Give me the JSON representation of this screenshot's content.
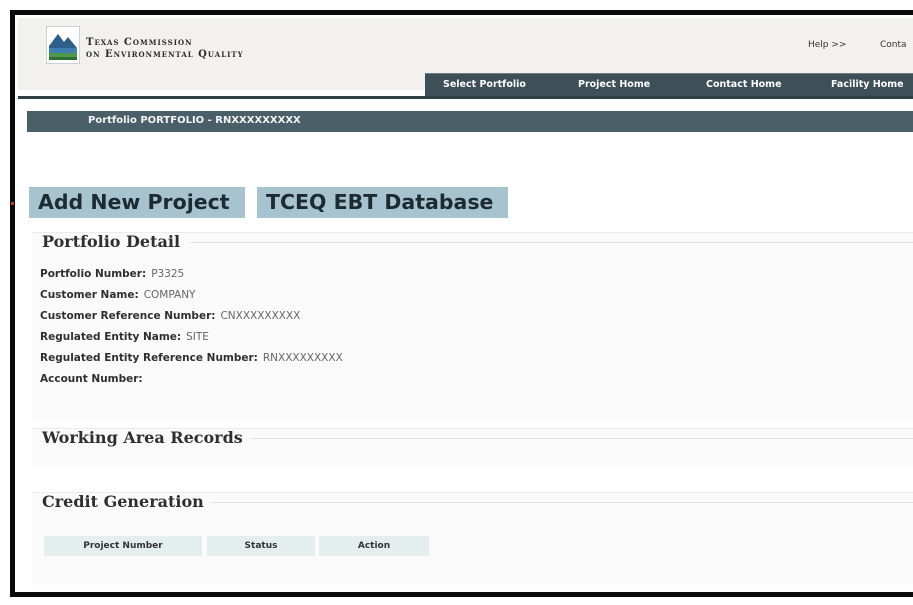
{
  "header": {
    "agency_line1": "Texas Commission",
    "agency_line2": "on Environmental Quality",
    "help_link": "Help >>",
    "contact_link": "Conta"
  },
  "nav": {
    "items": [
      "Select Portfolio",
      "Project Home",
      "Contact Home",
      "Facility Home"
    ]
  },
  "portfolio_bar": "Portfolio PORTFOLIO - RNXXXXXXXXX",
  "buttons": {
    "add_project": "Add New Project",
    "ebt_database": "TCEQ EBT Database"
  },
  "portfolio_detail": {
    "title": "Portfolio Detail",
    "fields": [
      {
        "label": "Portfolio Number:",
        "value": "P3325"
      },
      {
        "label": "Customer Name:",
        "value": "COMPANY"
      },
      {
        "label": "Customer Reference Number:",
        "value": "CNXXXXXXXXX"
      },
      {
        "label": "Regulated Entity Name:",
        "value": "SITE"
      },
      {
        "label": "Regulated Entity Reference Number:",
        "value": "RNXXXXXXXXX"
      },
      {
        "label": "Account Number:",
        "value": ""
      }
    ]
  },
  "working_area": {
    "title": "Working Area Records"
  },
  "credit_generation": {
    "title": "Credit Generation",
    "columns": [
      "Project Number",
      "Status",
      "Action"
    ]
  },
  "colors": {
    "nav_bg": "#3d4f57",
    "button_bg": "#a7c3d0",
    "header_bg": "#f2f1ee"
  }
}
